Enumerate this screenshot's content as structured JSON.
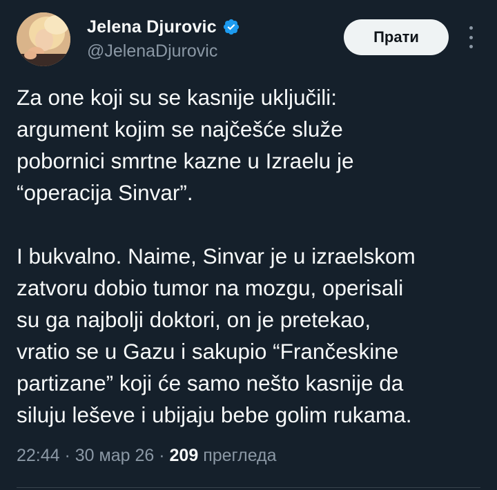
{
  "author": {
    "display_name": "Jelena Djurovic",
    "handle": "@JelenaDjurovic",
    "verified": true,
    "verified_color": "#1d9bf0"
  },
  "actions": {
    "follow_label": "Прати",
    "more_icon": "more-vertical-icon"
  },
  "tweet": {
    "text": "Za one koji su se kasnije uključili:\nargument kojim se najčešće služe\npobornici smrtne kazne u Izraelu je\n“operacija Sinvar”.\n\nI bukvalno. Naime, Sinvar je u izraelskom\nzatvoru dobio tumor na mozgu, operisali\nsu ga najbolji doktori, on je pretekao,\nvratio se u Gazu i sakupio “Frančeskine\npartizane” koji će samo nešto kasnije da\nsiluju leševe i ubijaju bebe golim rukama."
  },
  "meta": {
    "time": "22:44",
    "separator": " · ",
    "date": "30 мар 26",
    "views_count": "209",
    "views_label": "прегледа"
  },
  "colors": {
    "background": "#15202b",
    "text_primary": "#f7f9f9",
    "text_secondary": "#8b98a5",
    "follow_bg": "#eff3f4"
  }
}
